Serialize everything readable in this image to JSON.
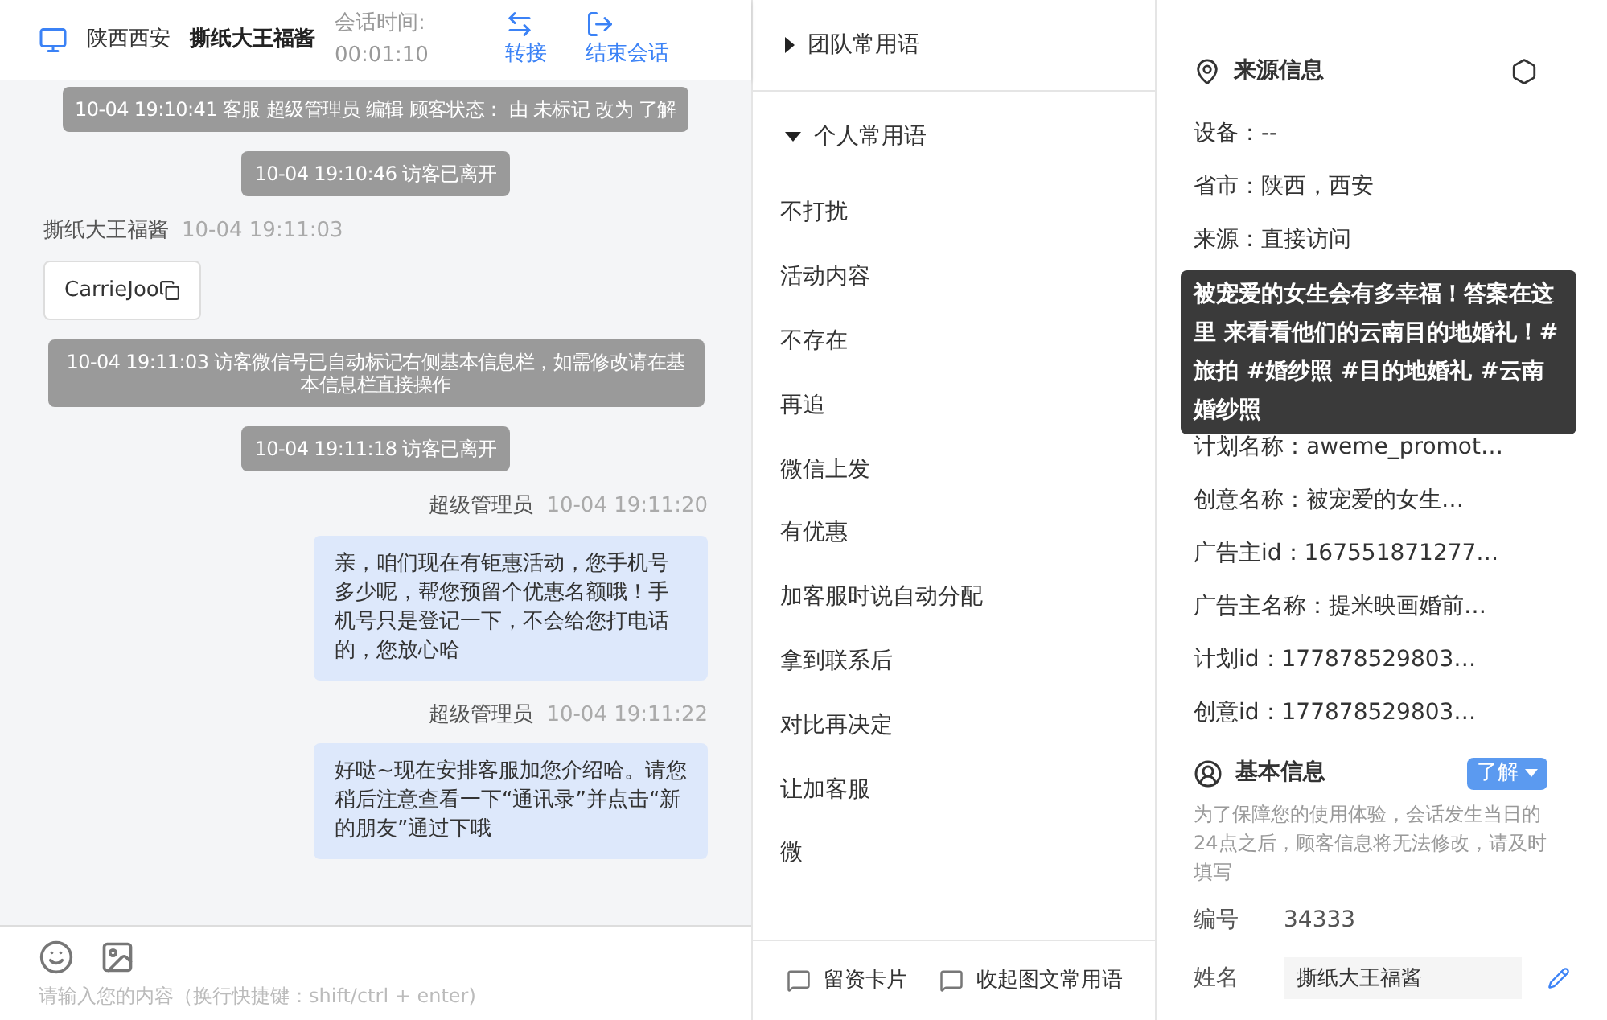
{
  "header": {
    "location": "陕西西安",
    "customer": "撕纸大王福酱",
    "session_label": "会话时间:",
    "session_time": "00:01:10",
    "actions": [
      {
        "kind": "transfer",
        "label": "转接"
      },
      {
        "kind": "end",
        "label": "结束会话"
      }
    ]
  },
  "messages": [
    {
      "kind": "system",
      "text": "10-04 19:10:41 客服 超级管理员 编辑 顾客状态： 由 未标记 改为 了解"
    },
    {
      "kind": "system",
      "text": "10-04 19:10:46 访客已离开"
    },
    {
      "kind": "customer",
      "sender": "撕纸大王福酱",
      "time": "10-04 19:11:03",
      "text": "CarrieJoo"
    },
    {
      "kind": "system",
      "text": "10-04 19:11:03 访客微信号已自动标记右侧基本信息栏，如需修改请在基本信息栏直接操作"
    },
    {
      "kind": "system",
      "text": "10-04 19:11:18 访客已离开"
    },
    {
      "kind": "agent",
      "sender": "超级管理员",
      "time": "10-04 19:11:20",
      "text": "亲，咱们现在有钜惠活动，您手机号多少呢，帮您预留个优惠名额哦！手机号只是登记一下，不会给您打电话的，您放心哈"
    },
    {
      "kind": "agent",
      "sender": "超级管理员",
      "time": "10-04 19:11:22",
      "text": "好哒~现在安排客服加您介绍哈。请您稍后注意查看一下“通讯录”并点击“新的朋友”通过下哦"
    }
  ],
  "composer": {
    "placeholder": "请输入您的内容（换行快捷键：shift/ctrl + enter)"
  },
  "phrase_groups": [
    {
      "label": "团队常用语",
      "expanded": false
    },
    {
      "label": "个人常用语",
      "expanded": true,
      "items": [
        "不打扰",
        "活动内容",
        "不存在",
        "再追",
        "微信上发",
        "有优惠",
        "加客服时说自动分配",
        "拿到联系后",
        "对比再决定",
        "让加客服",
        "微"
      ]
    }
  ],
  "phrase_footer": [
    "留资卡片",
    "收起图文常用语"
  ],
  "source_info": {
    "title": "来源信息",
    "fields": [
      "设备：--",
      "省市：陕西，西安",
      "来源：直接访问",
      "计划名称：aweme_promot…",
      "创意名称：被宠爱的女生…",
      "广告主id：167551871277…",
      "广告主名称：提米映画婚前…",
      "计划id：177878529803…",
      "创意id：177878529803…"
    ],
    "tooltip": "被宠爱的女生会有多幸福！答案在这里 来看看他们的云南目的地婚礼！#旅拍 #婚纱照 #目的地婚礼 #云南婚纱照"
  },
  "basic_info": {
    "title": "基本信息",
    "status": "了解",
    "note": "为了保障您的使用体验，会话发生当日的24点之后，顾客信息将无法修改，请及时填写",
    "fields": [
      {
        "kind": "text",
        "label": "编号",
        "value": "34333"
      },
      {
        "kind": "input",
        "label": "姓名",
        "value": "撕纸大王福酱"
      }
    ]
  }
}
